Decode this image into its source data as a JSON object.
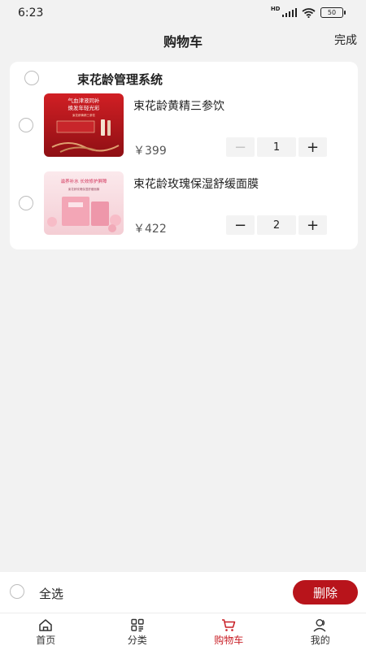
{
  "status": {
    "time": "6:23",
    "network": "HD",
    "battery": "50"
  },
  "nav": {
    "title": "购物车",
    "done_label": "完成"
  },
  "store": {
    "name": "束花龄管理系统"
  },
  "items": [
    {
      "name": "束花龄黄精三参饮",
      "price": "￥399",
      "quantity": "1",
      "thumb_text_1": "气血津液同补",
      "thumb_text_2": "焕发年轻光彩",
      "thumb_text_3": "束花龄黄精三参饮"
    },
    {
      "name": "束花龄玫瑰保湿舒缓面膜",
      "price": "￥422",
      "quantity": "2",
      "thumb_text_1": "滋养补水 长效修护屏障",
      "thumb_text_2": "束花龄玫瑰保湿舒缓面膜"
    }
  ],
  "bottom": {
    "select_all_label": "全选",
    "delete_label": "删除"
  },
  "tabs": [
    {
      "label": "首页",
      "icon": "home-icon"
    },
    {
      "label": "分类",
      "icon": "category-icon"
    },
    {
      "label": "购物车",
      "icon": "cart-icon",
      "active": true
    },
    {
      "label": "我的",
      "icon": "user-icon"
    }
  ],
  "colors": {
    "accent": "#c81d24",
    "delete_button": "#b8141b",
    "background": "#f2f2f2"
  }
}
